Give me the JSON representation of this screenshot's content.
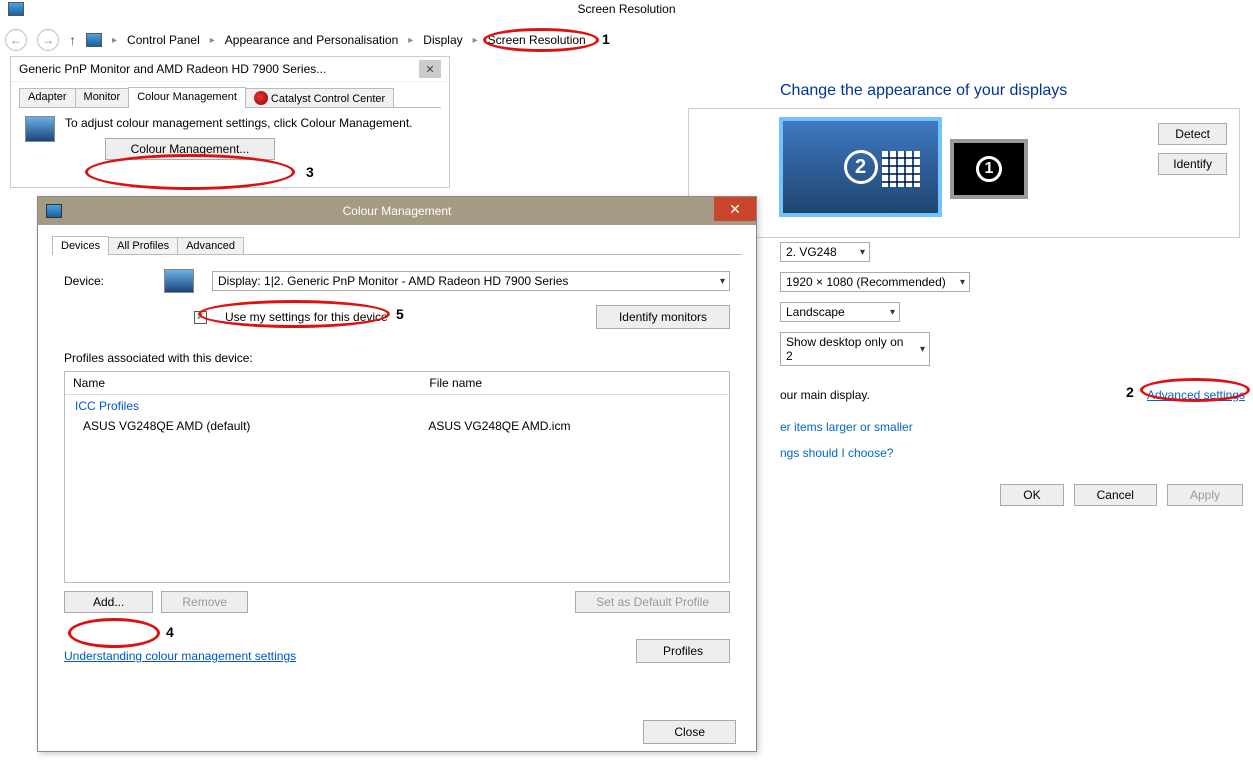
{
  "window_title": "Screen Resolution",
  "breadcrumb": [
    "Control Panel",
    "Appearance and Personalisation",
    "Display",
    "Screen Resolution"
  ],
  "screen_res": {
    "heading": "Change the appearance of your displays",
    "detect": "Detect",
    "identify": "Identify",
    "display_select": "2. VG248",
    "resolution_select": "1920 × 1080 (Recommended)",
    "orientation_select": "Landscape",
    "multi_select": "Show desktop only on 2",
    "main_display_fragment": "our main display.",
    "advanced_link": "Advanced settings",
    "link1": "er items larger or smaller",
    "link2": "ngs should I choose?",
    "ok": "OK",
    "cancel": "Cancel",
    "apply": "Apply"
  },
  "props": {
    "title": "Generic PnP Monitor and AMD Radeon HD 7900 Series...",
    "tabs": {
      "adapter": "Adapter",
      "monitor": "Monitor",
      "colour": "Colour Management",
      "catalyst": "Catalyst Control Center"
    },
    "body_text": "To adjust colour management settings, click Colour Management.",
    "button": "Colour Management..."
  },
  "cm": {
    "title": "Colour Management",
    "tabs": {
      "devices": "Devices",
      "all": "All Profiles",
      "advanced": "Advanced"
    },
    "device_label": "Device:",
    "device_select": "Display: 1|2. Generic PnP Monitor - AMD Radeon HD 7900 Series",
    "identify_btn": "Identify monitors",
    "use_my_settings": "Use my settings for this device",
    "profiles_label": "Profiles associated with this device:",
    "col_name": "Name",
    "col_file": "File name",
    "group": "ICC Profiles",
    "profile_name": "ASUS VG248QE AMD (default)",
    "profile_file": "ASUS VG248QE AMD.icm",
    "add": "Add...",
    "remove": "Remove",
    "set_default": "Set as Default Profile",
    "understanding": "Understanding colour management settings",
    "profiles_btn": "Profiles",
    "close": "Close"
  },
  "annotations": {
    "n1": "1",
    "n2": "2",
    "n3": "3",
    "n4": "4",
    "n5": "5"
  }
}
